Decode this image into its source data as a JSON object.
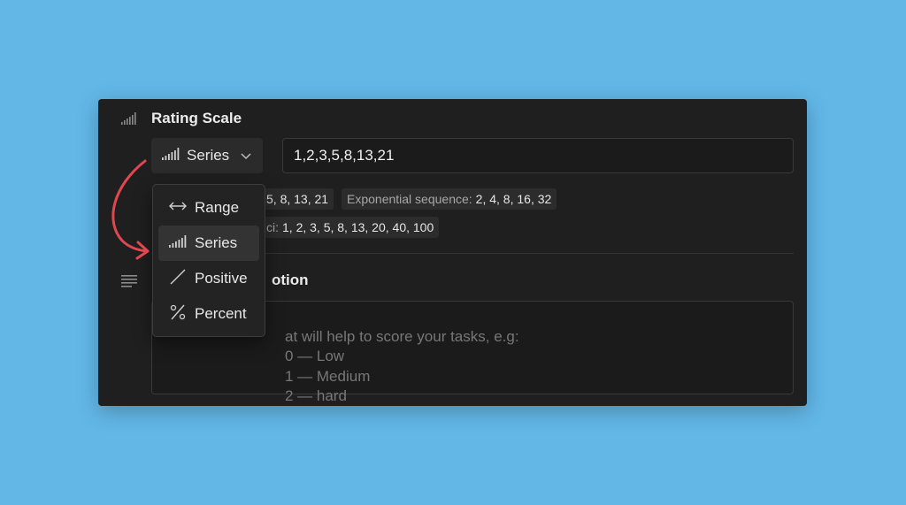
{
  "rating_scale": {
    "title": "Rating Scale",
    "row_icon": "signal-bars-icon",
    "type_button": {
      "label": "Series",
      "icon": "signal-bars-icon",
      "chevron": "chevron-down-icon"
    },
    "values_input": {
      "value": "1,2,3,5,8,13,21"
    },
    "examples": {
      "fib_partial": {
        "value": "5, 8, 13, 21"
      },
      "exponential": {
        "label": "Exponential sequence:",
        "value": "2, 4, 8, 16, 32"
      },
      "fib_modified": {
        "label": "ci:",
        "value": "1, 2, 3, 5, 8, 13, 20, 40, 100"
      }
    }
  },
  "description": {
    "row_icon": "text-lines-icon",
    "title": "otion",
    "placeholder_visible": "at will help to score your tasks, e.g:\n0 — Low\n1 — Medium\n2 — hard"
  },
  "dropdown": {
    "items": [
      {
        "label": "Range",
        "icon": "double-arrow-icon",
        "selected": false
      },
      {
        "label": "Series",
        "icon": "signal-bars-icon",
        "selected": true
      },
      {
        "label": "Positive",
        "icon": "diagonal-line-icon",
        "selected": false
      },
      {
        "label": "Percent",
        "icon": "percent-icon",
        "selected": false
      }
    ]
  },
  "colors": {
    "background": "#62b7e7",
    "panel": "#1f1f1f",
    "annotation_arrow": "#e0474f"
  }
}
